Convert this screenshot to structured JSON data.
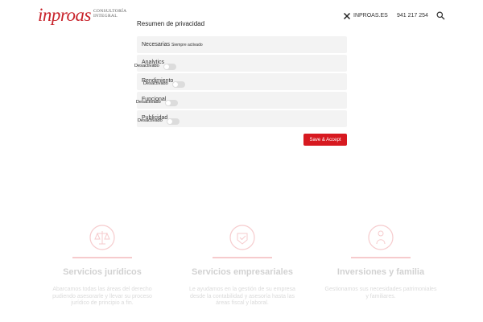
{
  "header": {
    "logo_word": "inproas",
    "logo_line1": "CONSULTORÍA",
    "logo_line2": "INTEGRAL",
    "site_link": "INPROAS.ES",
    "phone": "941 217 254"
  },
  "privacy": {
    "title": "Resumen de privacidad",
    "necessary": {
      "label": "Necesarias",
      "status": "Siempre activado"
    },
    "categories": [
      {
        "label": "Analytics",
        "state": "Desactivado"
      },
      {
        "label": "Rendimiento",
        "state": "Desactivado"
      },
      {
        "label": "Funcional",
        "state": "Desactivado"
      },
      {
        "label": "Publicidad",
        "state": "Desactivado"
      }
    ],
    "save_label": "Save & Accept"
  },
  "services": [
    {
      "title": "Servicios jurídicos",
      "text": "Abarcamos todas las áreas del derecho pudiendo asesorarle y llevar su proceso jurídico de principio a fin."
    },
    {
      "title": "Servicios empresariales",
      "text": "Le ayudamos en la gestión de su empresa desde la contabilidad y asesoría hasta las áreas fiscal y laboral."
    },
    {
      "title": "Inversiones y familia",
      "text": "Gestionamos sus necesidades patrimoniales y familiares."
    }
  ],
  "colors": {
    "brand": "#c8232b",
    "button": "#d71920",
    "panel": "#f3f3f3"
  }
}
